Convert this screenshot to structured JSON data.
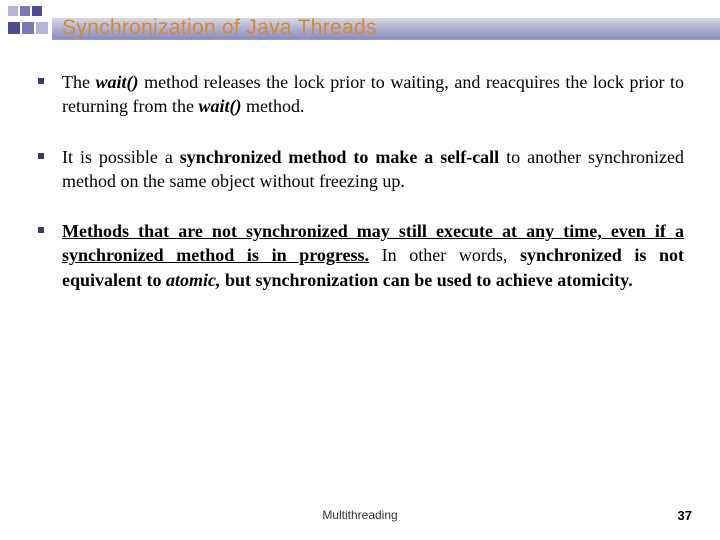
{
  "header": {
    "title": "Synchronization of Java Threads"
  },
  "bullets": {
    "b1": {
      "pre": "The ",
      "wait1": "wait()",
      "mid": " method releases the lock prior to waiting, and reacquires the lock prior to returning from the ",
      "wait2": "wait()",
      "post": " method."
    },
    "b2": {
      "pre": "It is possible a ",
      "bold": "synchronized method to make a self-call",
      "post": " to another synchronized method on the same object without freezing up."
    },
    "b3": {
      "bu": "Methods that are not synchronized may still execute at any time, even if a synchronized method is in progress.",
      "mid1": " In other words, ",
      "b1": "synchronized is not equivalent to ",
      "bi": "atomic,",
      "b2": " but synchronization can be used to achieve atomicity."
    }
  },
  "footer": {
    "title": "Multithreading",
    "page": "37"
  }
}
